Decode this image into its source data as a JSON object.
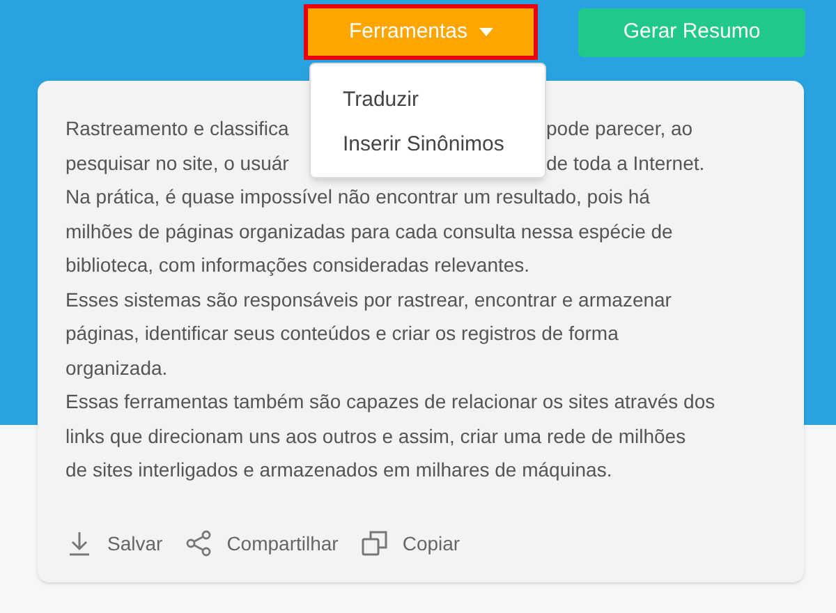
{
  "toolbar": {
    "tools_button": {
      "label": "Ferramentas",
      "expanded": true,
      "highlighted": true
    },
    "summary_button": {
      "label": "Gerar Resumo"
    }
  },
  "tools_menu": [
    {
      "label": "Traduzir"
    },
    {
      "label": "Inserir Sinônimos"
    }
  ],
  "result": {
    "partial_lines": [
      {
        "left": "Rastreamento e classifica",
        "right": "pode parecer, ao"
      },
      {
        "left": "pesquisar no site, o usuár",
        "right": "de toda a Internet."
      }
    ],
    "paragraphs": [
      [
        "Na prática, é quase impossível não encontrar um resultado, pois há",
        "milhões de páginas organizadas para cada consulta nessa espécie de",
        "biblioteca, com informações consideradas relevantes."
      ],
      [
        "Esses sistemas são responsáveis por rastrear, encontrar e armazenar",
        "páginas, identificar seus conteúdos e criar os registros de forma",
        "organizada."
      ],
      [
        "Essas ferramentas também são capazes de relacionar os sites através dos",
        "links que direcionam uns aos outros e assim, criar uma rede de milhões",
        "de sites interligados e armazenados em milhares de máquinas."
      ]
    ],
    "actions": [
      {
        "kind": "download",
        "label": "Salvar"
      },
      {
        "kind": "share",
        "label": "Compartilhar"
      },
      {
        "kind": "copy",
        "label": "Copiar"
      }
    ]
  }
}
